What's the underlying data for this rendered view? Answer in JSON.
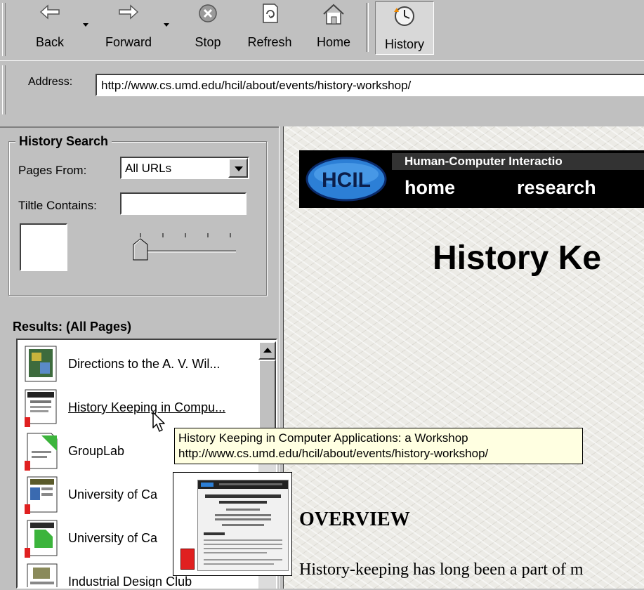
{
  "toolbar": {
    "back": "Back",
    "forward": "Forward",
    "stop": "Stop",
    "refresh": "Refresh",
    "home": "Home",
    "history": "History"
  },
  "address": {
    "label": "Address:",
    "url": "http://www.cs.umd.edu/hcil/about/events/history-workshop/"
  },
  "history_search": {
    "legend": "History Search",
    "pages_from_label": "Pages From:",
    "pages_from_value": "All URLs",
    "title_label": "Tiltle Contains:",
    "title_value": ""
  },
  "results": {
    "title": "Results: (All Pages)",
    "items": [
      {
        "title": "Directions to the A. V. Wil..."
      },
      {
        "title": "History Keeping in Compu..."
      },
      {
        "title": "GroupLab"
      },
      {
        "title": "University of Ca"
      },
      {
        "title": "University of Ca"
      },
      {
        "title": "Industrial Design Club"
      }
    ]
  },
  "tooltip": {
    "line1": "History Keeping in Computer Applications: a Workshop",
    "line2": "http://www.cs.umd.edu/hcil/about/events/history-workshop/"
  },
  "page": {
    "banner_org": "Human-Computer Interactio",
    "nav_home": "home",
    "nav_research": "research",
    "heading": "History Ke",
    "overview_heading": "OVERVIEW",
    "overview_text": "History-keeping has long been a part of m",
    "logo_text": "HCIL"
  },
  "colors": {
    "chrome": "#c0c0c0",
    "tooltip_bg": "#ffffe1",
    "banner": "#000000",
    "logo_blue": "#2c7fd6",
    "badge_red": "#e02020"
  }
}
